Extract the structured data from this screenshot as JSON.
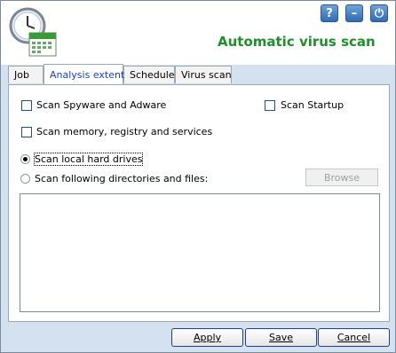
{
  "window": {
    "title": "Automatic virus scan",
    "title_color": "#1f8f2a",
    "buttons": {
      "help_label": "?",
      "minimize_label": "–",
      "power_label": "⏻"
    }
  },
  "tabs": [
    {
      "label": "Job",
      "active": false
    },
    {
      "label": "Analysis extent",
      "active": true
    },
    {
      "label": "Schedule",
      "active": false
    },
    {
      "label": "Virus scan",
      "active": false
    }
  ],
  "options": {
    "spyware": {
      "label": "Scan Spyware and Adware",
      "checked": false
    },
    "startup": {
      "label": "Scan Startup",
      "checked": false
    },
    "memory": {
      "label": "Scan memory, registry and services",
      "checked": false
    }
  },
  "scan_target": {
    "local": {
      "label": "Scan local hard drives",
      "selected": true
    },
    "directories": {
      "label": "Scan following directories and files:",
      "selected": false
    },
    "browse_label": "Browse",
    "items": []
  },
  "footer": {
    "apply_label": "Apply",
    "save_label": "Save",
    "cancel_label": "Cancel"
  },
  "colors": {
    "accent": "#1a3fcf",
    "background": "#d4e1ee",
    "button_border": "#1c3f94"
  }
}
